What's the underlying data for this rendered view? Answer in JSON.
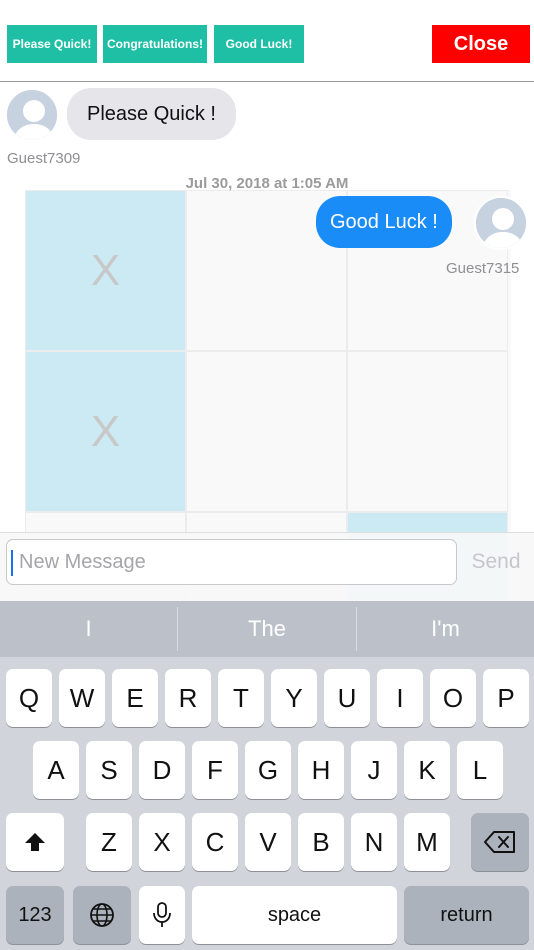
{
  "quick_buttons": [
    {
      "label": "Please Quick!"
    },
    {
      "label": "Congratulations!"
    },
    {
      "label": "Good Luck!"
    }
  ],
  "close_label": "Close",
  "board": {
    "cells": [
      {
        "mark": "X",
        "highlighted": true
      },
      {
        "mark": "",
        "highlighted": false
      },
      {
        "mark": "",
        "highlighted": false
      },
      {
        "mark": "X",
        "highlighted": true
      },
      {
        "mark": "",
        "highlighted": false
      },
      {
        "mark": "",
        "highlighted": false
      },
      {
        "mark": "",
        "highlighted": false
      },
      {
        "mark": "",
        "highlighted": false
      },
      {
        "mark": "",
        "highlighted": true
      }
    ],
    "highlight_color": "#cbeaf3"
  },
  "chat": {
    "incoming": {
      "text": "Please Quick !",
      "user": "Guest7309"
    },
    "timestamp": "Jul 30, 2018 at 1:05 AM",
    "outgoing": {
      "text": "Good Luck !",
      "user": "Guest7315"
    }
  },
  "composer": {
    "placeholder": "New Message",
    "value": "",
    "send_label": "Send"
  },
  "keyboard": {
    "suggestions": [
      "I",
      "The",
      "I'm"
    ],
    "row1": [
      "Q",
      "W",
      "E",
      "R",
      "T",
      "Y",
      "U",
      "I",
      "O",
      "P"
    ],
    "row2": [
      "A",
      "S",
      "D",
      "F",
      "G",
      "H",
      "J",
      "K",
      "L"
    ],
    "row3": [
      "Z",
      "X",
      "C",
      "V",
      "B",
      "N",
      "M"
    ],
    "numbers_label": "123",
    "space_label": "space",
    "return_label": "return",
    "icons": {
      "shift": "shift-icon",
      "backspace": "backspace-icon",
      "globe": "globe-icon",
      "mic": "microphone-icon"
    }
  },
  "colors": {
    "accent_teal": "#1fbfa6",
    "close_red": "#fe0000",
    "outgoing_bubble": "#1a8cf8",
    "incoming_bubble": "#e5e5ea"
  }
}
